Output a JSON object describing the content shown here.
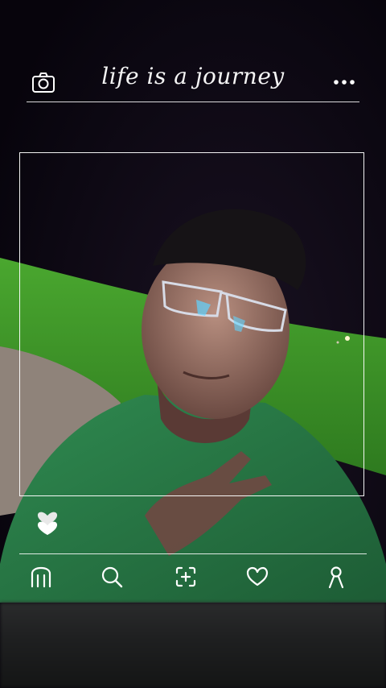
{
  "header": {
    "title": "life is a journey",
    "icons": {
      "left": "camera-icon",
      "right": "more-dots-icon"
    }
  },
  "overlay": {
    "heart_icon": "stacked-hearts-icon"
  },
  "bottom_nav": {
    "items": [
      {
        "name": "home",
        "icon": "home-icon"
      },
      {
        "name": "search",
        "icon": "search-icon"
      },
      {
        "name": "add",
        "icon": "add-post-icon"
      },
      {
        "name": "likes",
        "icon": "heart-icon"
      },
      {
        "name": "profile",
        "icon": "profile-icon"
      }
    ]
  },
  "colors": {
    "night_sky": "#0b0712",
    "grass": "#3f9b2c",
    "shirt": "#2e7f4b",
    "frame_white": "#ffffff"
  }
}
